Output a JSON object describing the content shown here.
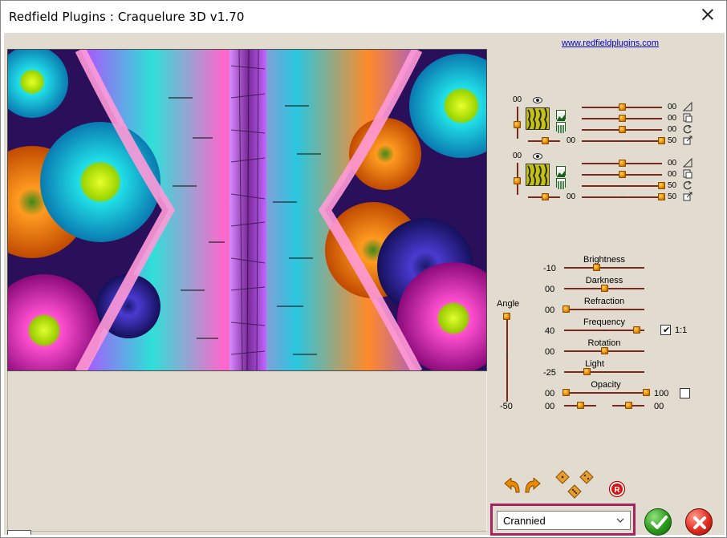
{
  "window": {
    "title": "Redfield Plugins : Craquelure 3D  v1.70"
  },
  "link": {
    "text": "www.redfieldplugins.com"
  },
  "layer1": {
    "left_value": "00",
    "bottom_value": "00",
    "rows": [
      {
        "value": "00",
        "icon": "triangle-icon"
      },
      {
        "value": "00",
        "icon": "page-icon"
      },
      {
        "value": "00",
        "icon": "rotate-icon"
      },
      {
        "value": "50",
        "icon": "export-icon"
      }
    ]
  },
  "layer2": {
    "left_value": "00",
    "bottom_value": "00",
    "rows": [
      {
        "value": "00",
        "icon": "triangle-icon"
      },
      {
        "value": "00",
        "icon": "page-icon"
      },
      {
        "value": "50",
        "icon": "rotate-icon"
      },
      {
        "value": "50",
        "icon": "export-icon"
      }
    ]
  },
  "params": {
    "angle_label": "Angle",
    "angle_value": "-50",
    "brightness": {
      "label": "Brightness",
      "value": "-10"
    },
    "darkness": {
      "label": "Darkness",
      "value": "00"
    },
    "refraction": {
      "label": "Refraction",
      "value": "00"
    },
    "frequency": {
      "label": "Frequency",
      "value": "40",
      "lock_label": "1:1",
      "lock_checked": true
    },
    "rotation": {
      "label": "Rotation",
      "value": "00"
    },
    "light": {
      "label": "Light",
      "value": "-25"
    },
    "opacity": {
      "label": "Opacity",
      "min_value": "00",
      "max_value": "100",
      "checked": false
    },
    "offset": {
      "left_value": "00",
      "right_value": "00"
    }
  },
  "preset": {
    "selected": "Crannied"
  },
  "colors": {
    "background": "#e1dccf",
    "slider_track": "#7a2a1a",
    "knob": "#e38a00",
    "highlight_border": "#a3245e"
  }
}
